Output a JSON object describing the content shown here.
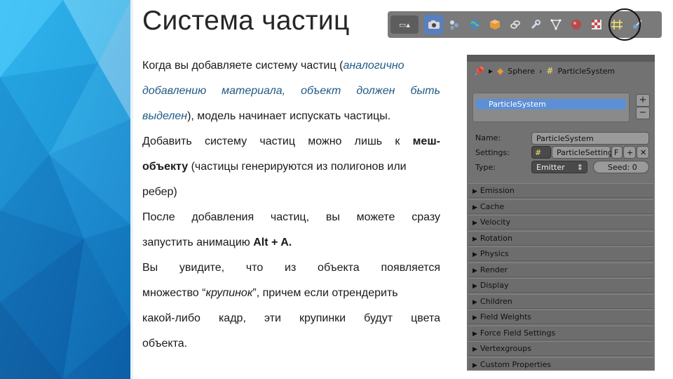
{
  "slide": {
    "title": "Система частиц",
    "paragraphs": {
      "p1": {
        "l1_a": "Когда вы добавляете систему частиц (",
        "l1_b": "аналогично",
        "l2": "добавлению материала, объект должен быть",
        "l3_a": "выделен",
        "l3_b": "), модель начинает испускать частицы."
      },
      "p2": {
        "l1_a": "Добавить систему частиц можно лишь к ",
        "l1_b": "меш-",
        "l2_a": "объекту",
        "l2_b": " (частицы генерируются из полигонов или",
        "l3": "ребер)"
      },
      "p3": {
        "l1": "После добавления частиц, вы можете сразу",
        "l2_a": "запустить анимацию ",
        "l2_b": "Alt + A."
      },
      "p4": {
        "l1": "Вы увидите, что из объекта появляется",
        "l2_a": "множество “",
        "l2_b": "крупинок",
        "l2_c": "”, причем если отрендерить",
        "l3": "какой-либо кадр, эти крупинки будут цвета",
        "l4": "объекта."
      }
    }
  },
  "toolbar": {
    "icons": [
      "render-icon",
      "scene-icon",
      "world-icon",
      "object-icon",
      "constraints-icon",
      "modifiers-icon",
      "data-icon",
      "material-icon",
      "texture-icon",
      "particles-icon",
      "physics-icon"
    ],
    "active": "render-icon",
    "highlighted": "particles-icon"
  },
  "panel": {
    "breadcrumb": {
      "object": "Sphere",
      "system": "ParticleSystem"
    },
    "list_item": "ParticleSystem",
    "add_label": "+",
    "remove_label": "−",
    "name_label": "Name:",
    "name_value": "ParticleSystem",
    "settings_label": "Settings:",
    "settings_value": "ParticleSettings",
    "settings_f": "F",
    "settings_plus": "+",
    "settings_x": "✕",
    "type_label": "Type:",
    "type_value": "Emitter",
    "seed_label": "Seed:",
    "seed_value": "0",
    "sections": [
      "Emission",
      "Cache",
      "Velocity",
      "Rotation",
      "Physics",
      "Render",
      "Display",
      "Children",
      "Field Weights",
      "Force Field Settings",
      "Vertexgroups",
      "Custom Properties"
    ]
  },
  "colors": {
    "accent_blue": "#1f5a86",
    "deco_light": "#35b5f0",
    "deco_dark": "#0a5ea8",
    "selection": "#5c8fd6"
  }
}
